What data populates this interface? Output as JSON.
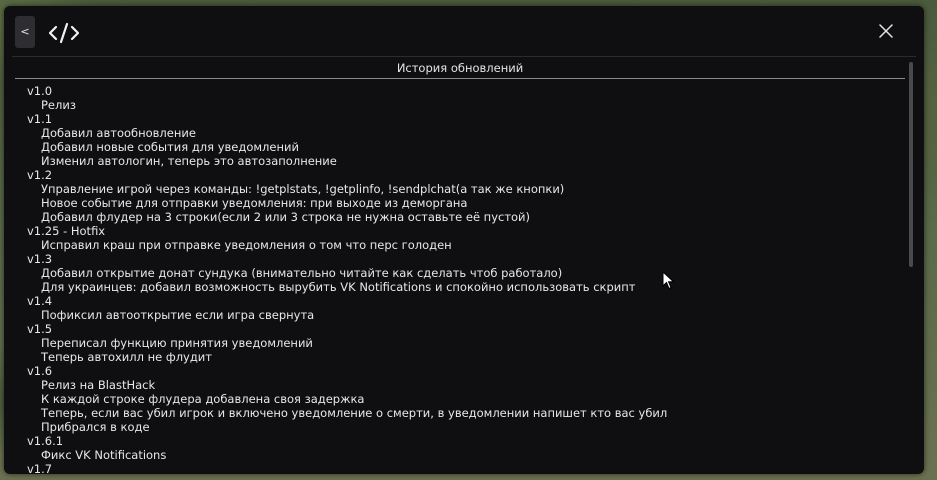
{
  "toolbar": {
    "back_label": "<",
    "code_icon": "code-brackets-icon",
    "close_icon": "close-icon"
  },
  "section": {
    "title": "История обновлений"
  },
  "changelog": [
    {
      "text": "v1.0",
      "kind": "version"
    },
    {
      "text": "Релиз",
      "kind": "change"
    },
    {
      "text": "v1.1",
      "kind": "version"
    },
    {
      "text": "Добавил автообновление",
      "kind": "change"
    },
    {
      "text": "Добавил новые события для уведомлений",
      "kind": "change"
    },
    {
      "text": "Изменил автологин, теперь это автозаполнение",
      "kind": "change"
    },
    {
      "text": "v1.2",
      "kind": "version"
    },
    {
      "text": "Управление игрой через команды: !getplstats, !getplinfo, !sendplchat(а так же кнопки)",
      "kind": "change"
    },
    {
      "text": "Новое событие для отправки уведомления: при выходе из деморгана",
      "kind": "change"
    },
    {
      "text": "Добавил флудер на 3 строки(если 2 или 3 строка не нужна оставьте её пустой)",
      "kind": "change"
    },
    {
      "text": "v1.25 - Hotfix",
      "kind": "version"
    },
    {
      "text": "Исправил краш при отправке уведомления о том что перс голоден",
      "kind": "change"
    },
    {
      "text": "v1.3",
      "kind": "version"
    },
    {
      "text": "Добавил открытие донат сундука (внимательно читайте как сделать чтоб работало)",
      "kind": "change"
    },
    {
      "text": "Для украинцев: добавил возможность вырубить VK Notifications и спокойно использовать скрипт",
      "kind": "change"
    },
    {
      "text": "v1.4",
      "kind": "version"
    },
    {
      "text": "Пофиксил автооткрытие если игра свернута",
      "kind": "change"
    },
    {
      "text": "v1.5",
      "kind": "version"
    },
    {
      "text": "Переписал функцию принятия уведомлений",
      "kind": "change"
    },
    {
      "text": "Теперь автохилл не флудит",
      "kind": "change"
    },
    {
      "text": "v1.6",
      "kind": "version"
    },
    {
      "text": "Релиз на BlastHack",
      "kind": "change"
    },
    {
      "text": "К каждой строке флудера добавлена своя задержка",
      "kind": "change"
    },
    {
      "text": "Теперь, если вас убил игрок и включено уведомление о смерти, в уведомлении напишет кто вас убил",
      "kind": "change"
    },
    {
      "text": "Прибрался в коде",
      "kind": "change"
    },
    {
      "text": "v1.6.1",
      "kind": "version"
    },
    {
      "text": "Фикс VK Notifications",
      "kind": "change"
    },
    {
      "text": "v1.7",
      "kind": "version"
    }
  ],
  "scroll": {
    "position_fraction": 0.0,
    "visible_fraction": 0.5
  },
  "colors": {
    "panel": "#0f0f11",
    "text": "#e8e8e8",
    "divider": "#8a8a8a",
    "scroll_thumb": "#4a4a4e"
  }
}
